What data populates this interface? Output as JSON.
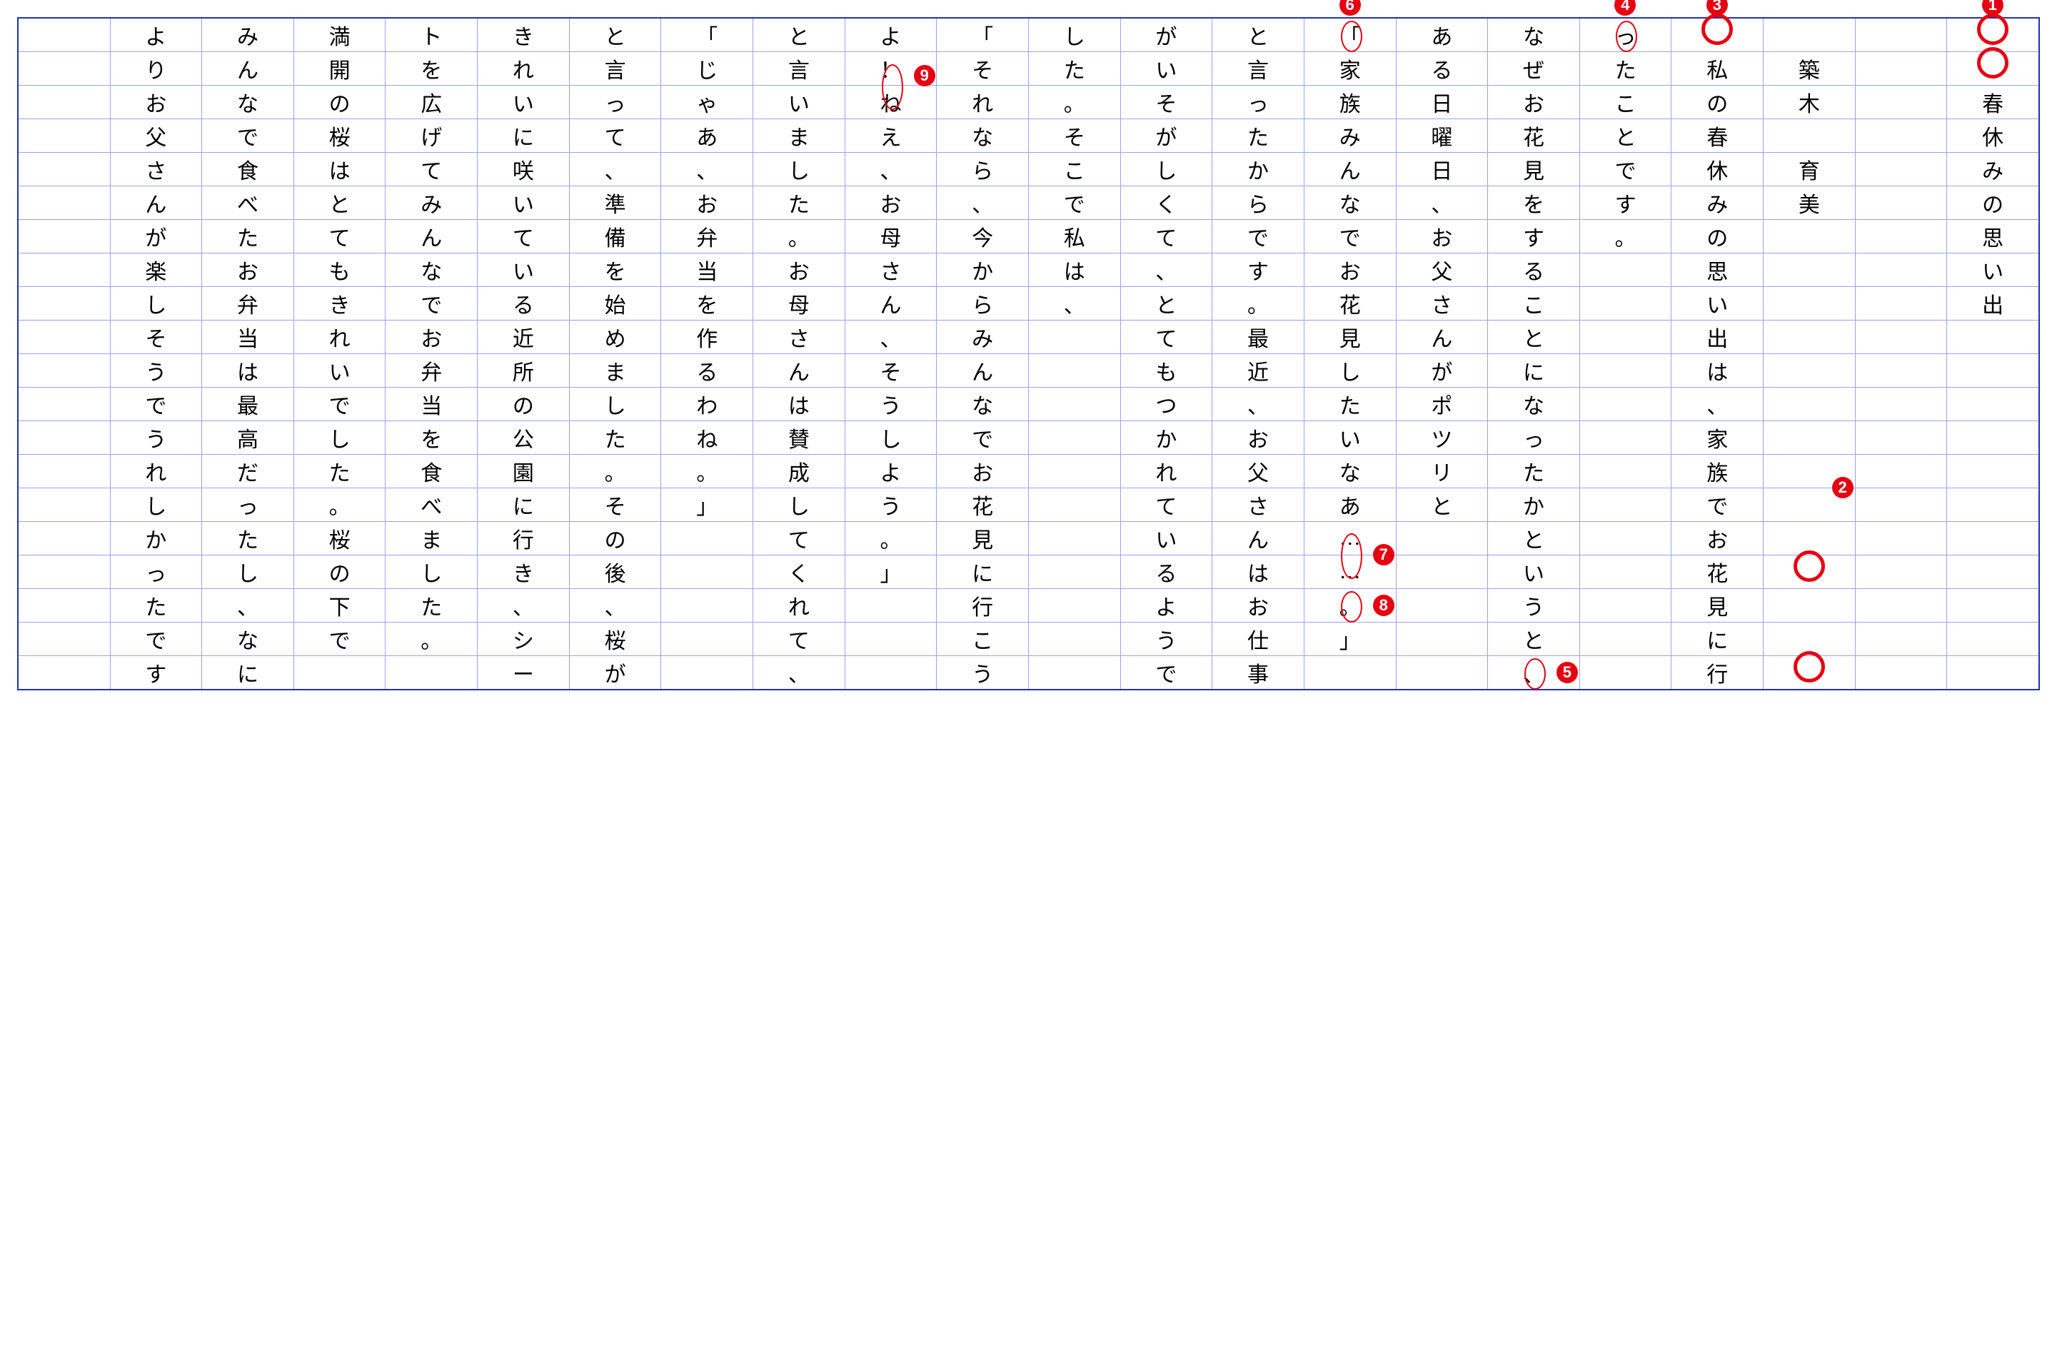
{
  "grid": {
    "rows": 20,
    "cols": 22,
    "columns_right_to_left": [
      "〇〇春休みの思い出",
      "",
      "②築木〇育美〇",
      "〇私の春休みの思い出は、家族でお花見に行",
      "ったことです。",
      "なぜお花見をすることになったかというと、",
      "ある日曜日、お父さんがポツリと",
      "「家族みんなでお花見したいなあ……。」",
      "と言ったからです。最近、お父さんはお仕事",
      "がいそがしくて、とてもつかれているようで",
      "した。そこで私は、",
      "「それなら、今からみんなでお花見に行こう",
      "よ！ねえ、お母さん、そうしよう。」",
      "と言いました。お母さんは賛成してくれて、",
      "「じゃあ、お弁当を作るわね。」",
      "と言って、準備を始めました。その後、桜が",
      "きれいに咲いている近所の公園に行き、シー",
      "トを広げてみんなでお弁当を食べました。",
      "満開の桜はとてもきれいでした。桜の下で",
      "みんなで食べたお弁当は最高だったし、なに",
      "よりお父さんが楽しそうでうれしかったです。",
      ""
    ]
  },
  "annotations": [
    {
      "id": "1",
      "type": "circNum",
      "label": "❶",
      "col": 0,
      "row": -1
    },
    {
      "id": "1O1",
      "type": "bigO",
      "col": 0,
      "row": 0
    },
    {
      "id": "1O2",
      "type": "bigO",
      "col": 0,
      "row": 1
    },
    {
      "id": "2",
      "type": "circNum",
      "label": "❷",
      "col": 2,
      "row": 13.5
    },
    {
      "id": "2O1",
      "type": "bigO",
      "col": 2,
      "row": 16
    },
    {
      "id": "2O2",
      "type": "bigO",
      "col": 2,
      "row": 19
    },
    {
      "id": "3",
      "type": "circNum",
      "label": "❸",
      "col": 3,
      "row": -1
    },
    {
      "id": "3O",
      "type": "bigO",
      "col": 3,
      "row": 0
    },
    {
      "id": "4",
      "type": "circNum",
      "label": "❹",
      "col": 4,
      "row": -1
    },
    {
      "id": "4E",
      "type": "ellipseV",
      "col": 4,
      "row": 0
    },
    {
      "id": "5",
      "type": "circNum",
      "label": "❺",
      "col": 5,
      "row": 19,
      "side": "right"
    },
    {
      "id": "5E",
      "type": "ellipseV",
      "col": 5,
      "row": 19
    },
    {
      "id": "6",
      "type": "circNum",
      "label": "❻",
      "col": 7,
      "row": -1
    },
    {
      "id": "6E",
      "type": "ellipseV",
      "col": 7,
      "row": 0
    },
    {
      "id": "7",
      "type": "circNum",
      "label": "❼",
      "col": 7,
      "row": 15.5,
      "side": "right"
    },
    {
      "id": "7E",
      "type": "ellipseVbig",
      "col": 7,
      "row": 15.5
    },
    {
      "id": "8",
      "type": "circNum",
      "label": "❽",
      "col": 7,
      "row": 17,
      "side": "right"
    },
    {
      "id": "8E",
      "type": "ellipseV",
      "col": 7,
      "row": 17
    },
    {
      "id": "9",
      "type": "circNum",
      "label": "❾",
      "col": 12,
      "row": 1.2,
      "side": "right"
    },
    {
      "id": "9E",
      "type": "ellipseVbig",
      "col": 12,
      "row": 1.5
    }
  ]
}
